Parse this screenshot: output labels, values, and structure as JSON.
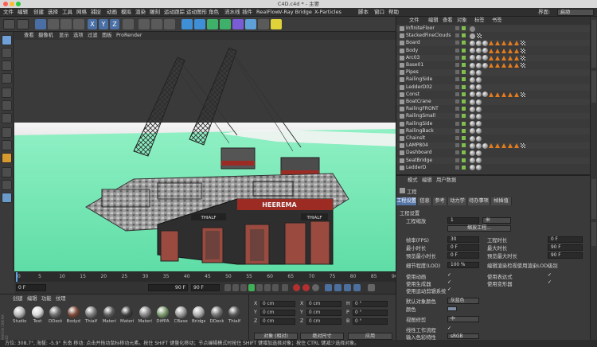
{
  "window": {
    "title": "C4D.c4d * - 主要"
  },
  "menu": {
    "items": [
      "文件",
      "编辑",
      "创建",
      "选择",
      "工具",
      "网格",
      "捕捉",
      "动画",
      "模拟",
      "渲染",
      "雕刻",
      "运动跟踪",
      "运动图形",
      "角色",
      "流水线",
      "插件",
      "RealFlow",
      "V-Ray Bridge",
      "X-Particles",
      "脚本",
      "窗口",
      "帮助"
    ],
    "layout_label": "界面:",
    "layout_value": "启动"
  },
  "viewport": {
    "menu": [
      "查看",
      "摄像机",
      "显示",
      "选项",
      "过滤",
      "面板",
      "ProRender"
    ],
    "hull_label": "HEEREMA",
    "sub_label": "THIALF",
    "ship_text_right": "THIALF"
  },
  "timeline": {
    "ticks": [
      "0",
      "5",
      "10",
      "15",
      "20",
      "25",
      "30",
      "35",
      "40",
      "45",
      "50",
      "55",
      "60",
      "65",
      "70",
      "75",
      "80",
      "85",
      "90"
    ],
    "current_frame": "0 F",
    "start_frame": "0 F",
    "end_frame": "90 F",
    "end_frame_2": "90 F",
    "right_frame": "0 F"
  },
  "materials": {
    "menu": [
      "创建",
      "编辑",
      "功能",
      "纹理"
    ],
    "items": [
      {
        "name": "Studio",
        "color": "#b9b9b9"
      },
      {
        "name": "Test",
        "color": "#d9d9d9"
      },
      {
        "name": "DDeck",
        "color": "#6d6d6d"
      },
      {
        "name": "Bodyd",
        "color": "#7c4a38"
      },
      {
        "name": "Thialf",
        "color": "#7d7d7d"
      },
      {
        "name": "Materi",
        "color": "#5b5b5b"
      },
      {
        "name": "Materi",
        "color": "#3d3d3d"
      },
      {
        "name": "Materi",
        "color": "#888888"
      },
      {
        "name": "DiffPA",
        "color": "#7c9a6e"
      },
      {
        "name": "CBase",
        "color": "#9a9a9a"
      },
      {
        "name": "Bridge",
        "color": "#b0b0b0"
      },
      {
        "name": "DDeck",
        "color": "#737373"
      },
      {
        "name": "Thialf",
        "color": "#555555"
      }
    ],
    "logo": "MAXON CINEMA 4D"
  },
  "coordinates": {
    "rows": [
      {
        "axis": "X",
        "pos": "0 cm",
        "axis2": "X",
        "size": "0 cm",
        "rot_axis": "H",
        "rot": "0 °"
      },
      {
        "axis": "Y",
        "pos": "0 cm",
        "axis2": "Y",
        "size": "0 cm",
        "rot_axis": "P",
        "rot": "0 °"
      },
      {
        "axis": "Z",
        "pos": "0 cm",
        "axis2": "Z",
        "size": "0 cm",
        "rot_axis": "B",
        "rot": "0 °"
      }
    ],
    "mode_object": "对象 (相对)",
    "mode_size": "绝对尺寸",
    "apply": "应用"
  },
  "status": {
    "text": "方位: 308.7°, 海拔: -5.9° 东南  移动: 点击并拖动鼠标移动元素。按住 SHIFT 键量化移动；节点编辑模式时按住 SHIFT 键增加选择对象；按住 CTRL 键减少选择对象。"
  },
  "objects": {
    "menu": [
      "文件",
      "编辑",
      "查看",
      "对象",
      "标签",
      "书签"
    ],
    "rows": [
      {
        "name": "InfiniteFloor",
        "tags": "t"
      },
      {
        "name": "StackedFineClouds",
        "tags": "c"
      },
      {
        "name": "Board",
        "tags": "m"
      },
      {
        "name": "Body",
        "tags": "m"
      },
      {
        "name": "Arc03",
        "tags": "m"
      },
      {
        "name": "Base01",
        "tags": "m"
      },
      {
        "name": "Pipes",
        "tags": "s"
      },
      {
        "name": "RailingSide",
        "tags": "s"
      },
      {
        "name": "LedderD02",
        "tags": "s"
      },
      {
        "name": "Const",
        "tags": "m"
      },
      {
        "name": "BoatCrane",
        "tags": "s"
      },
      {
        "name": "RailingFRONT",
        "tags": "s"
      },
      {
        "name": "RailingSmall",
        "tags": "s"
      },
      {
        "name": "RailingSide",
        "tags": "s"
      },
      {
        "name": "RailingBack",
        "tags": "s"
      },
      {
        "name": "Chainslt",
        "tags": "s"
      },
      {
        "name": "LAMP804",
        "tags": "m"
      },
      {
        "name": "Dashboard",
        "tags": "s"
      },
      {
        "name": "SeatBridge",
        "tags": "s"
      },
      {
        "name": "LedderD",
        "tags": "s"
      }
    ]
  },
  "attributes": {
    "menu": [
      "模式",
      "编辑",
      "用户数据"
    ],
    "header": "工程",
    "tabs": [
      "工程设置",
      "信息",
      "参考",
      "动力学",
      "待办事项",
      "帧插值"
    ],
    "section": "工程设置",
    "scale_label": "工程缩放",
    "scale_value": "1",
    "scale_unit": "米",
    "scale_button": "缩放工程...",
    "fps_label": "帧率(FPS)",
    "fps_value": "30",
    "min_label": "最小时长",
    "min_value": "0 F",
    "preview_min_label": "预览最小时长",
    "preview_min_value": "0 F",
    "lod_label": "细节程度(LOD)",
    "lod_value": "100 %",
    "project_time_label": "工程时长",
    "project_time_value": "0 F",
    "max_label": "最大时长",
    "max_value": "90 F",
    "preview_max_label": "预览最大时长",
    "preview_max_value": "90 F",
    "lod_render_label": "编辑渲染检视使用渲染LOD级别",
    "use_anim": "使用动画",
    "use_expr": "使用表达式",
    "use_gen": "使用生成器",
    "use_deform": "使用变形器",
    "use_motion": "使用运动剪辑系统",
    "default_color_label": "默认对象颜色",
    "default_color_value": "灰蓝色",
    "color_label": "颜色",
    "view_clip_label": "视图修剪",
    "view_clip_value": "中",
    "linear_label": "线性工作流程",
    "input_color_label": "输入色彩特性",
    "input_color_value": "sRGB"
  },
  "palette": {
    "sea": "#6fe8b4",
    "sky": "#f2f2f2",
    "hull_red": "#9c2b24",
    "accent_blue": "#5474a6",
    "tag_orange": "#e37b1f"
  }
}
